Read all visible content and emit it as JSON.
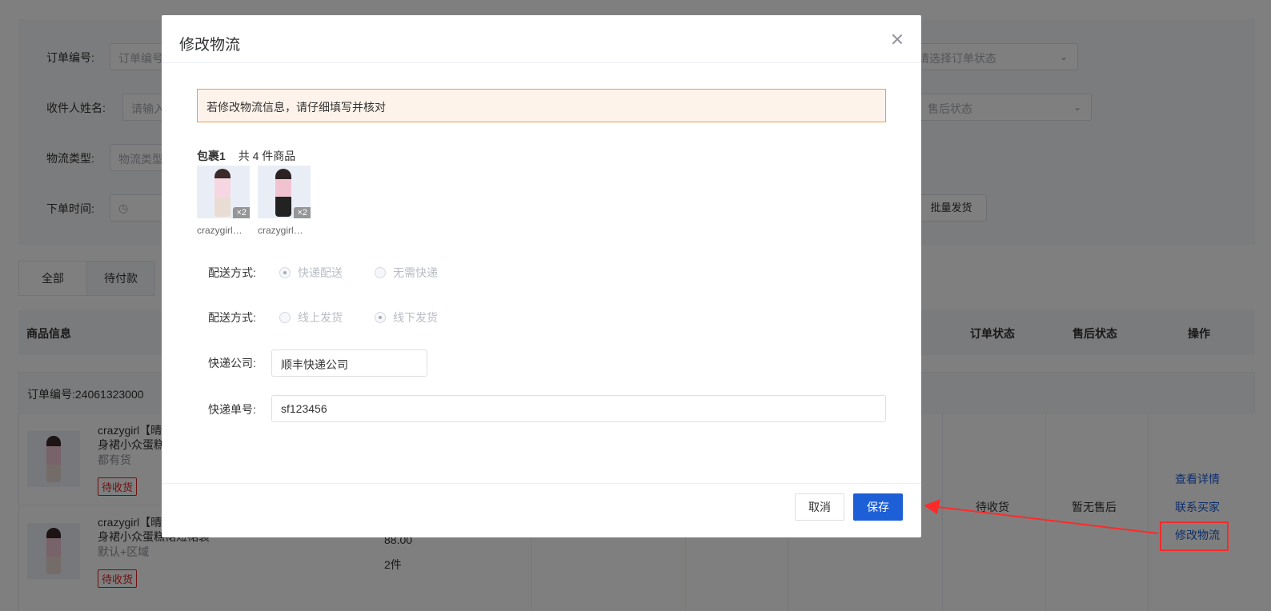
{
  "background": {
    "filters": {
      "order_no_label": "订单编号:",
      "order_no_placeholder": "订单编号",
      "order_status_placeholder": "请选择订单状态",
      "receiver_label": "收件人姓名:",
      "receiver_placeholder": "请输入",
      "aftersale_placeholder": "售后状态",
      "logistics_type_label": "物流类型:",
      "logistics_type_placeholder": "物流类型",
      "order_time_label": "下单时间:",
      "batch_ship_button": "批量发货"
    },
    "tabs": [
      {
        "label": "全部"
      },
      {
        "label": "待付款"
      }
    ],
    "table_headers": {
      "product_info": "商品信息",
      "order_status": "订单状态",
      "aftersale_status": "售后状态",
      "actions": "操作"
    },
    "order": {
      "order_no": "订单编号:24061323000",
      "products": [
        {
          "name": "crazygirl【晴",
          "name2": "身裙小众蛋糕",
          "spec": "都有货",
          "status": "待收货"
        },
        {
          "name": "crazygirl【晴",
          "name2": "身裙小众蛋糕裙短裙装",
          "spec": "默认+区域",
          "status": "待收货",
          "price": "88.00",
          "qty": "2件"
        }
      ],
      "order_status": "待收货",
      "aftersale_status": "暂无售后",
      "actions": {
        "view_detail": "查看详情",
        "contact_buyer": "联系买家",
        "modify_logistics": "修改物流"
      }
    }
  },
  "dialog": {
    "title": "修改物流",
    "alert": "若修改物流信息，请仔细填写并核对",
    "package": {
      "title": "包裹1",
      "count_text": "共 4 件商品",
      "items": [
        {
          "name": "crazygirl【晴天】",
          "qty": "×2"
        },
        {
          "name": "crazygirl【晴天】",
          "qty": "×2"
        }
      ]
    },
    "delivery_method": {
      "label": "配送方式:",
      "options": [
        "快递配送",
        "无需快递"
      ],
      "selected": "快递配送"
    },
    "shipping_method": {
      "label": "配送方式:",
      "options": [
        "线上发货",
        "线下发货"
      ],
      "selected": "线下发货"
    },
    "courier_company": {
      "label": "快递公司:",
      "value": "顺丰快递公司"
    },
    "tracking_no": {
      "label": "快递单号:",
      "value": "sf123456"
    },
    "buttons": {
      "cancel": "取消",
      "save": "保存"
    }
  },
  "colors": {
    "primary": "#1d5fd6",
    "annotation": "#ff2a2a",
    "alert_border": "#f09a4b",
    "alert_bg": "#fdf3ea"
  }
}
